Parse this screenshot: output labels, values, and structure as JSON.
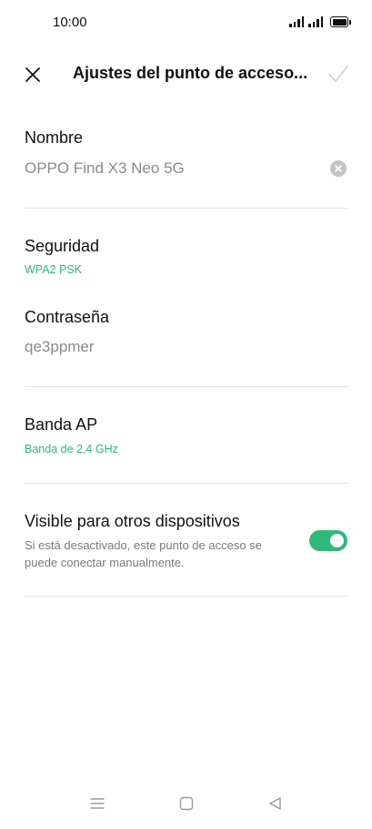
{
  "status_bar": {
    "time": "10:00"
  },
  "header": {
    "title": "Ajustes del punto de acceso..."
  },
  "fields": {
    "name": {
      "label": "Nombre",
      "value": "OPPO Find X3 Neo 5G"
    },
    "security": {
      "label": "Seguridad",
      "value": "WPA2 PSK"
    },
    "password": {
      "label": "Contraseña",
      "value": "qe3ppmer"
    },
    "band": {
      "label": "Banda AP",
      "value": "Banda de 2,4 GHz"
    },
    "visible": {
      "label": "Visible para otros dispositivos",
      "description": "Si está desactivado, este punto de acceso se puede conectar manualmente.",
      "enabled": true
    }
  },
  "colors": {
    "accent": "#2db97a",
    "text": "#111111",
    "muted": "#8a8a8a"
  },
  "icons": [
    "close-icon",
    "check-icon",
    "clear-icon",
    "menu-icon",
    "home-icon",
    "back-icon"
  ]
}
